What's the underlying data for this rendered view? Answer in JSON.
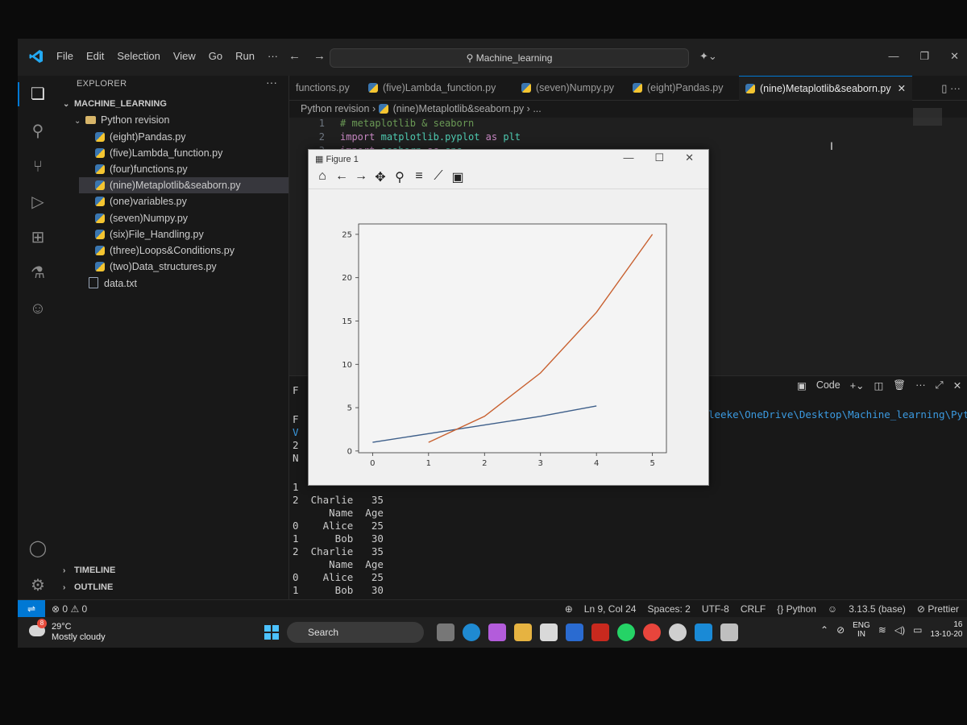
{
  "titlebar": {
    "menu": [
      "File",
      "Edit",
      "Selection",
      "View",
      "Go",
      "Run",
      "···"
    ],
    "search": "Machine_learning"
  },
  "explorer": {
    "title": "EXPLORER",
    "root": "MACHINE_LEARNING",
    "folder": "Python revision",
    "files": [
      "(eight)Pandas.py",
      "(five)Lambda_function.py",
      "(four)functions.py",
      "(nine)Metaplotlib&seaborn.py",
      "(one)variables.py",
      "(seven)Numpy.py",
      "(six)File_Handling.py",
      "(three)Loops&Conditions.py",
      "(two)Data_structures.py"
    ],
    "extra_file": "data.txt",
    "timeline": "TIMELINE",
    "outline": "OUTLINE"
  },
  "tabs": [
    {
      "label": "functions.py",
      "active": false
    },
    {
      "label": "(five)Lambda_function.py",
      "active": false
    },
    {
      "label": "(seven)Numpy.py",
      "active": false
    },
    {
      "label": "(eight)Pandas.py",
      "active": false
    },
    {
      "label": "(nine)Metaplotlib&seaborn.py",
      "active": true
    }
  ],
  "breadcrumb": {
    "folder": "Python revision",
    "file": "(nine)Metaplotlib&seaborn.py",
    "rest": "..."
  },
  "editor": {
    "lines": [
      {
        "num": "1",
        "comment": "# metaplotlib & seaborn"
      },
      {
        "num": "2",
        "kw": "import",
        "mod": "matplotlib.pyplot",
        "as": "as",
        "alias": "plt"
      },
      {
        "num": "3",
        "kw": "import",
        "mod": "seaborn",
        "as": "as",
        "alias": "sns"
      }
    ]
  },
  "panel": {
    "code_label": "Code",
    "path": "leeke\\OneDrive\\Desktop\\Machine_learning\\Python re",
    "left_fragments": [
      "F",
      "F",
      "V",
      "2",
      "N",
      "1"
    ],
    "output": [
      "2  Charlie   35",
      "      Name  Age",
      "0    Alice   25",
      "1      Bob   30",
      "2  Charlie   35",
      "      Name  Age",
      "0    Alice   25",
      "1      Bob   30"
    ]
  },
  "statusbar": {
    "problems": "0",
    "warnings": "0",
    "position": "Ln 9, Col 24",
    "spaces": "Spaces: 2",
    "encoding": "UTF-8",
    "eol": "CRLF",
    "language": "Python",
    "interpreter": "3.13.5 (base)",
    "prettier": "Prettier"
  },
  "taskbar": {
    "temp": "29°C",
    "weather": "Mostly cloudy",
    "badge": "8",
    "search": "Search",
    "lang": "ENG",
    "region": "IN",
    "date": "13-10-20",
    "time": "16"
  },
  "figure": {
    "window_title": "Figure 1",
    "toolbar_icons": [
      "home-icon",
      "back-icon",
      "forward-icon",
      "pan-icon",
      "zoom-icon",
      "configure-icon",
      "edit-axis-icon",
      "save-icon"
    ]
  },
  "chart_data": {
    "type": "line",
    "xlim": [
      -0.25,
      5.25
    ],
    "ylim": [
      -0.2,
      26.2
    ],
    "xticks": [
      0,
      1,
      2,
      3,
      4,
      5
    ],
    "yticks": [
      0,
      5,
      10,
      15,
      20,
      25
    ],
    "series": [
      {
        "color": "#3e5f8a",
        "x": [
          0,
          1,
          2,
          3,
          4
        ],
        "y": [
          1,
          2,
          3,
          4,
          5.2
        ]
      },
      {
        "color": "#c8602f",
        "x": [
          1,
          2,
          3,
          4,
          5
        ],
        "y": [
          1,
          4,
          9,
          16,
          25
        ]
      }
    ],
    "grid": false
  }
}
